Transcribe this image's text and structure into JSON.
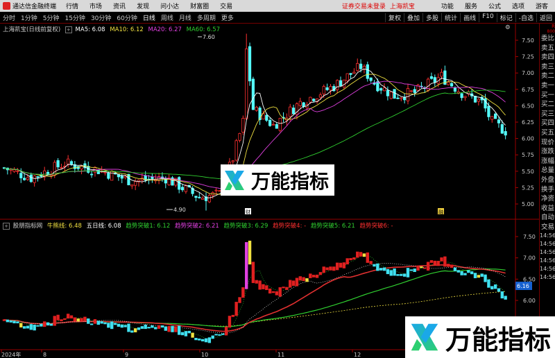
{
  "menubar": {
    "app_title": "通达信金融终端",
    "items": [
      "行情",
      "市场",
      "资讯",
      "发现",
      "问小达",
      "财富圈",
      "交易"
    ],
    "notice": "证券交易未登录",
    "symbol": "上海凯宝",
    "right_items": [
      "功能",
      "服务",
      "公式",
      "选项"
    ],
    "guest": "游客"
  },
  "toolbar": {
    "periods": [
      "分时",
      "1分钟",
      "5分钟",
      "15分钟",
      "30分钟",
      "60分钟",
      "日线",
      "周线",
      "月线",
      "多周期",
      "更多"
    ],
    "active_period": "日线",
    "right_buttons": [
      "复权",
      "叠加",
      "多股",
      "统计",
      "画线",
      "F10",
      "标记",
      "-自选",
      "返回"
    ]
  },
  "main_legend": {
    "title": "上海凯宝(日线前复权)",
    "ma5": "MA5: 6.08",
    "ma10": "MA10: 6.12",
    "ma20": "MA20: 6.27",
    "ma60": "MA60: 6.57",
    "colors": {
      "ma5": "#ffffff",
      "ma10": "#f0e040",
      "ma20": "#e040e0",
      "ma60": "#30d030"
    }
  },
  "indicator_legend": {
    "name": "股朋指标网",
    "items": [
      {
        "label": "牛熊线: 6.48",
        "color": "#f0e040"
      },
      {
        "label": "五日线: 6.08",
        "color": "#ffffff"
      },
      {
        "label": "趋势突破1: 6.12",
        "color": "#30d030"
      },
      {
        "label": "趋势突破2: 6.21",
        "color": "#e040e0"
      },
      {
        "label": "趋势突破3: 6.29",
        "color": "#30d030"
      },
      {
        "label": "趋势突破4: -",
        "color": "#ff3030"
      },
      {
        "label": "趋势突破5: 6.21",
        "color": "#30d030"
      },
      {
        "label": "趋势突破6: -",
        "color": "#ff3030"
      }
    ]
  },
  "top_right_label": "7.60",
  "price_axis_main": [
    "7.50",
    "7.25",
    "7.00",
    "6.75",
    "6.50",
    "6.25",
    "6.00",
    "5.75",
    "5.50",
    "5.25",
    "5.00"
  ],
  "price_axis_ind": [
    "7.50",
    "7.00",
    "6.50",
    "6.00"
  ],
  "ind_current_price": "6.16",
  "annotations": {
    "high": "7.60",
    "low": "4.90",
    "marker1": "财",
    "marker2": "融"
  },
  "time_axis": [
    "2024年",
    "8",
    "9",
    "10",
    "11",
    "12"
  ],
  "side_panel_top": [
    "R",
    "800"
  ],
  "side_panel": [
    "委比",
    "卖五",
    "卖四",
    "卖三",
    "卖二",
    "卖一",
    "买一",
    "买二",
    "买三",
    "买四",
    "买五",
    "现价",
    "涨跌",
    "涨幅",
    "总量",
    "外盘",
    "换手",
    "净资",
    "收益",
    "自动",
    "交易",
    "14:56",
    "14:56",
    "14:56",
    "14:56",
    "14:56",
    "14:56"
  ],
  "watermark": {
    "text": "万能指标"
  }
}
